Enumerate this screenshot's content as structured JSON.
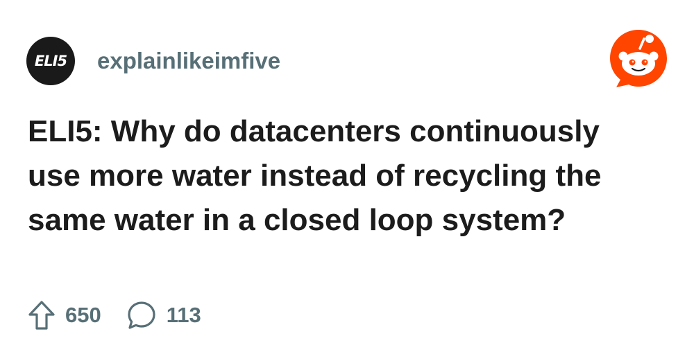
{
  "subreddit": {
    "avatar_text": "ELI5",
    "name": "explainlikeimfive"
  },
  "post": {
    "title": "ELI5: Why do datacenters continuously use more water instead of recycling the same water in a closed loop system?"
  },
  "stats": {
    "upvotes": "650",
    "comments": "113"
  },
  "icons": {
    "brand": "reddit-logo-icon",
    "upvote": "upvote-arrow-icon",
    "comment": "comment-bubble-icon"
  },
  "colors": {
    "brand": "#ff4500",
    "muted": "#576f76",
    "text": "#1c1c1c",
    "avatar_bg": "#1a1a1b"
  }
}
